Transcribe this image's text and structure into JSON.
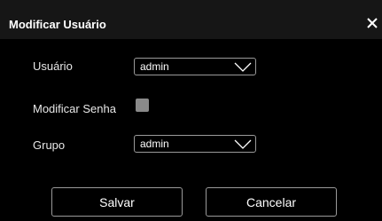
{
  "dialog": {
    "title": "Modificar Usuário",
    "close_icon": "close-icon"
  },
  "form": {
    "user_label": "Usuário",
    "user_value": "admin",
    "modify_password_label": "Modificar Senha",
    "modify_password_checked": false,
    "group_label": "Grupo",
    "group_value": "admin"
  },
  "buttons": {
    "save_label": "Salvar",
    "cancel_label": "Cancelar"
  },
  "colors": {
    "background": "#000000",
    "title_bar": "#161616",
    "border": "#9a9a9a",
    "checkbox": "#8a8a8a"
  }
}
